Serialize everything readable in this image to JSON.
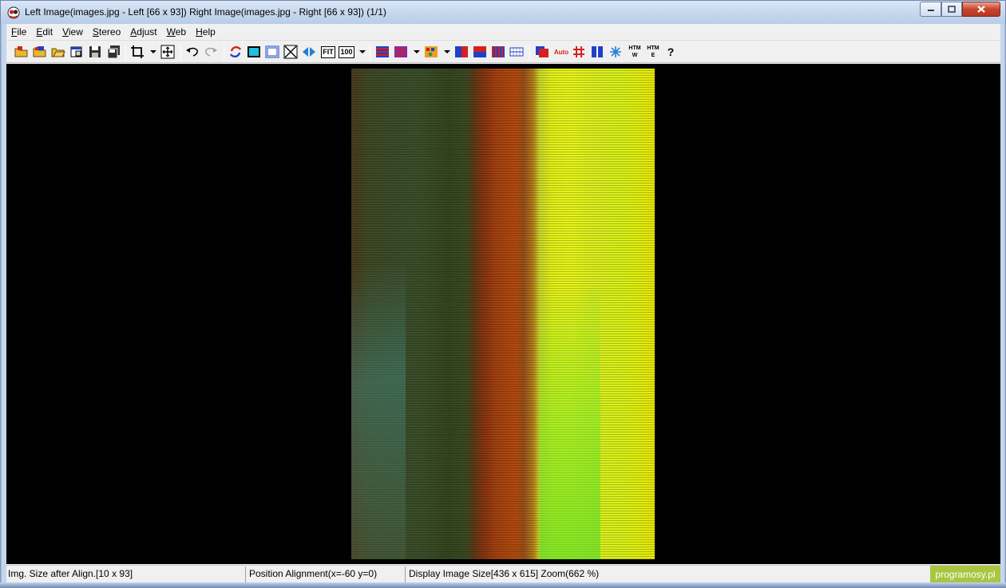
{
  "window": {
    "title": "Left Image(images.jpg - Left [66 x 93]) Right Image(images.jpg - Right [66 x 93])  (1/1)"
  },
  "menu": {
    "file_acc": "F",
    "file_rest": "ile",
    "edit_acc": "E",
    "edit_rest": "dit",
    "view_acc": "V",
    "view_rest": "iew",
    "stereo_acc": "S",
    "stereo_rest": "tereo",
    "adjust_acc": "A",
    "adjust_rest": "djust",
    "web_acc": "W",
    "web_rest": "eb",
    "help_acc": "H",
    "help_rest": "elp"
  },
  "toolbar": {
    "fit_label": "FIT",
    "zoom100_label": "100",
    "auto_label": "Auto",
    "htm_w_label": "HTM",
    "htm_w_sub": "W",
    "htm_e_label": "HTM",
    "htm_e_sub": "E",
    "help_label": "?"
  },
  "status": {
    "img_size": "Img. Size after Align.[10 x 93]",
    "position": "Position Alignment(x=-60 y=0)",
    "display": "Display Image Size[436 x 615]  Zoom(662 %)",
    "watermark": "programosy.pl"
  },
  "colors": {
    "client_bg": "#000000",
    "accent_red": "#d42020",
    "accent_blue": "#2040c8",
    "watermark_bg": "#a8c640"
  }
}
